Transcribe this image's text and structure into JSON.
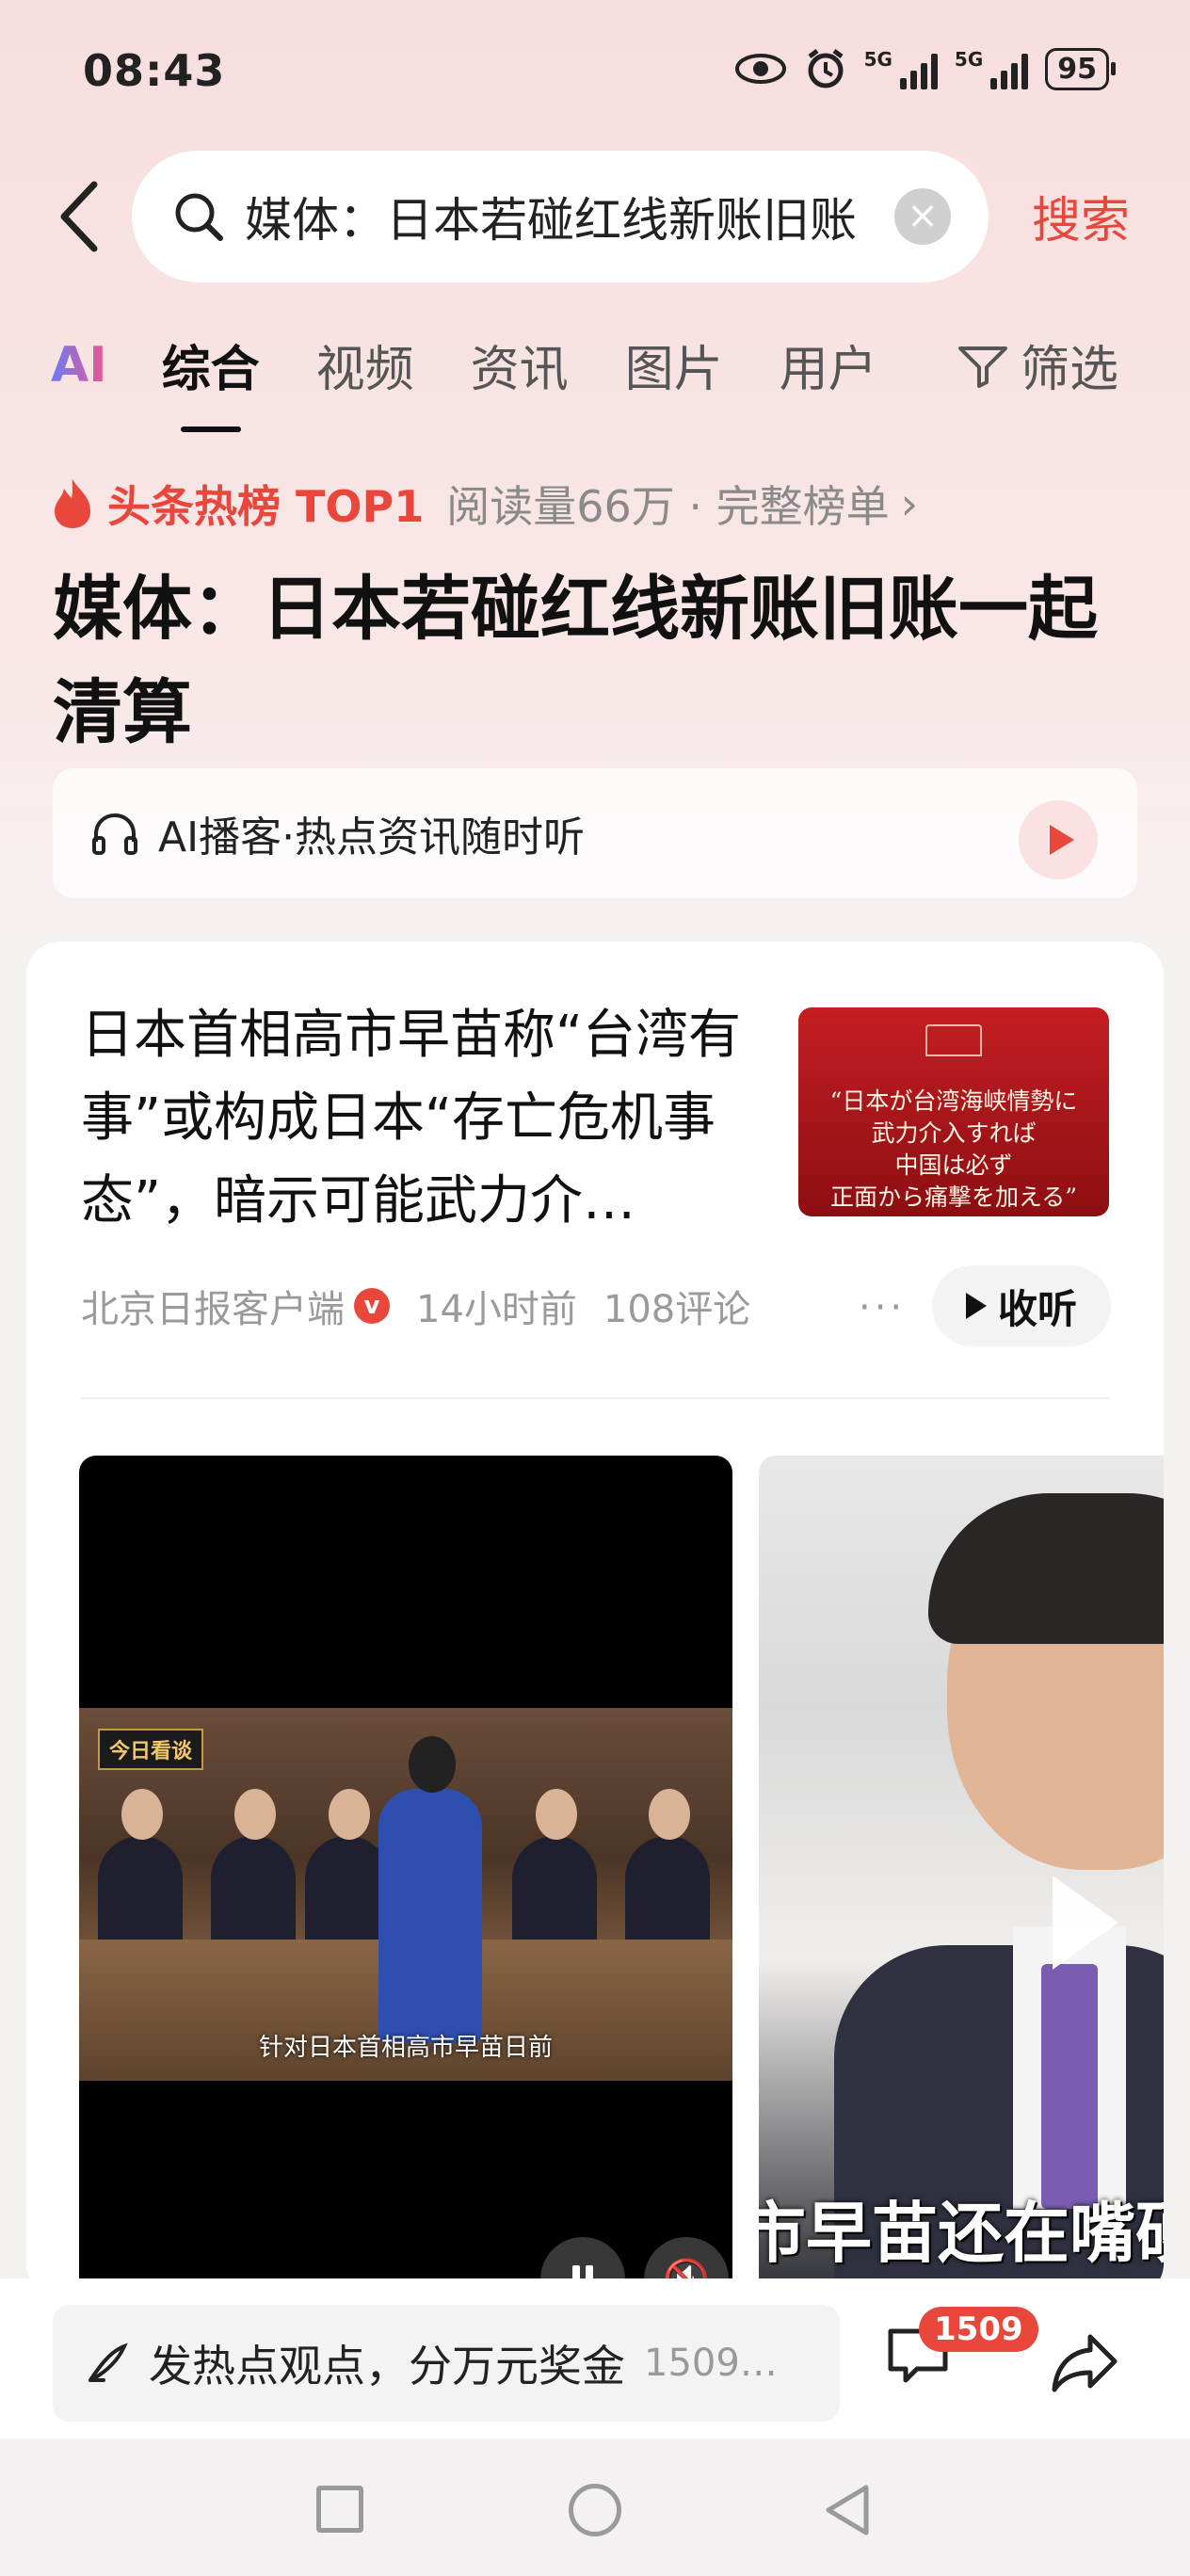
{
  "status_bar": {
    "time": "08:43",
    "signal1": "5G",
    "signal2": "5G",
    "battery": "95"
  },
  "search": {
    "query": "媒体：日本若碰红线新账旧账一起清算",
    "search_button": "搜索"
  },
  "tabs": [
    {
      "label": "AI"
    },
    {
      "label": "综合"
    },
    {
      "label": "视频"
    },
    {
      "label": "资讯"
    },
    {
      "label": "图片"
    },
    {
      "label": "用户"
    }
  ],
  "filter_label": "筛选",
  "hot": {
    "title": "头条热榜 TOP1",
    "subtitle": "阅读量66万 · 完整榜单",
    "headline": "媒体：日本若碰红线新账旧账一起清算"
  },
  "podcast": {
    "label": "AI播客·热点资讯随时听"
  },
  "article": {
    "title": "日本首相高市早苗称“台湾有事”或构成日本“存亡危机事态”，暗示可能武力介…",
    "thumbnail_lines": [
      "“日本が台湾海峡情勢に",
      "武力介入すれば",
      "中国は必ず",
      "正面から痛撃を加える”"
    ],
    "source": "北京日报客户端",
    "verified_badge": "v",
    "time": "14小时前",
    "comments": "108评论",
    "listen_label": "收听"
  },
  "videos": [
    {
      "logo": "今日看谈",
      "subtitle": "针对日本首相高市早苗日前"
    },
    {
      "caption": "市早苗还在嘴硬"
    }
  ],
  "bottom": {
    "comment_prompt": "发热点观点，分万元奖金",
    "comment_count_inline": "1509…",
    "comment_badge": "1509"
  },
  "colors": {
    "accent": "#e9473c",
    "background": "#f7dede"
  }
}
